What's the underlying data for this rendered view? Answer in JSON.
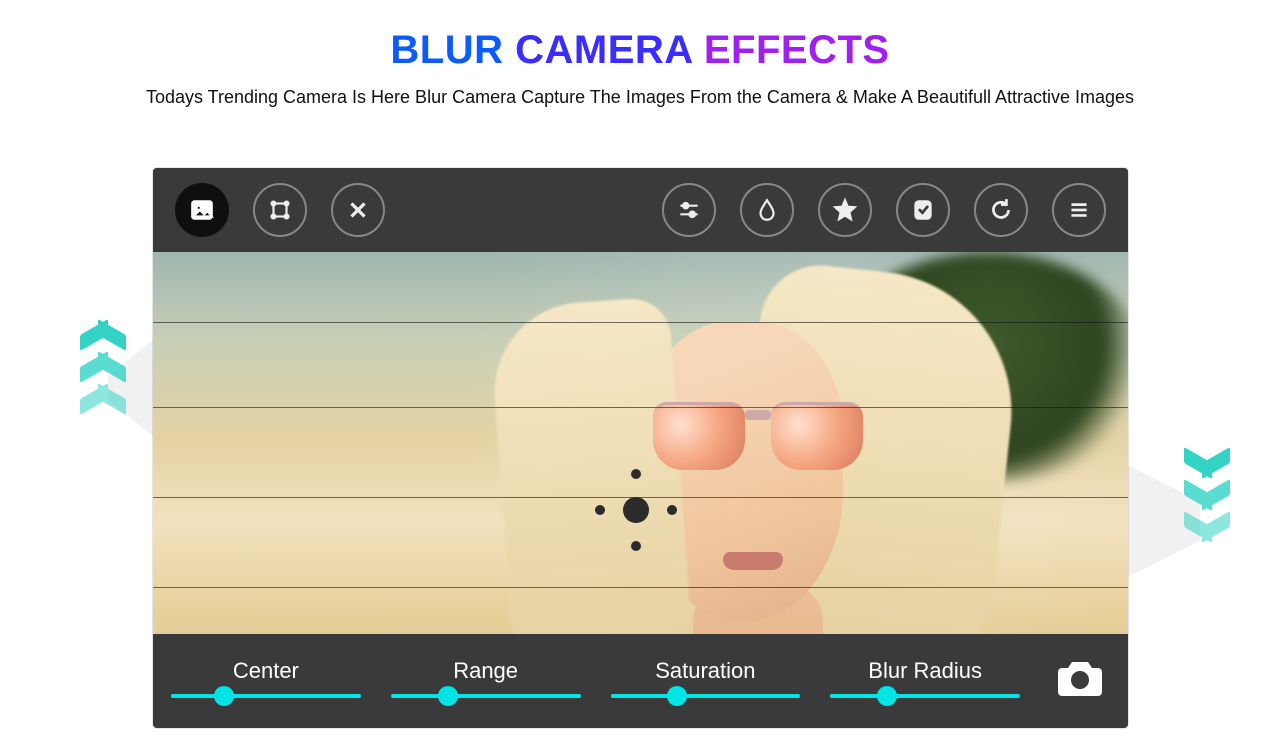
{
  "title": {
    "w1": "BLUR",
    "w2": "CAMERA",
    "w3": "EFFECTS"
  },
  "subtitle": "Todays Trending Camera Is Here Blur Camera Capture The Images From the Camera & Make A Beautifull Attractive Images",
  "toolbar": {
    "gallery": "gallery",
    "crop": "crop",
    "close": "close",
    "adjust": "adjust",
    "blur": "blur",
    "favorite": "favorite",
    "save": "save",
    "reset": "reset",
    "menu": "menu"
  },
  "sliders": {
    "center": {
      "label": "Center",
      "pos": 28
    },
    "range": {
      "label": "Range",
      "pos": 30
    },
    "saturation": {
      "label": "Saturation",
      "pos": 35
    },
    "blur_radius": {
      "label": "Blur Radius",
      "pos": 30
    }
  },
  "accent": "#00e5e5",
  "gridlines": [
    70,
    155,
    245,
    335,
    400
  ]
}
